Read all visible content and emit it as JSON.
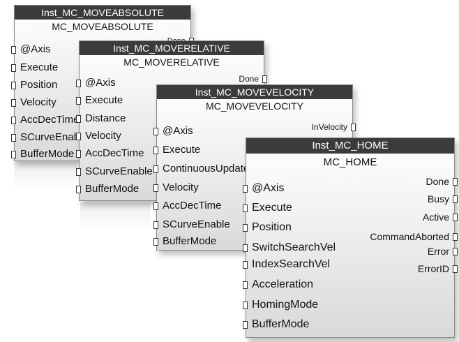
{
  "blocks": [
    {
      "instance": "Inst_MC_MOVEABSOLUTE",
      "type": "MC_MOVEABSOLUTE",
      "inputs": [
        "@Axis",
        "Execute",
        "Position",
        "Velocity",
        "AccDecTime",
        "SCurveEnable",
        "BufferMode"
      ],
      "outputs": [
        "Done"
      ]
    },
    {
      "instance": "Inst_MC_MOVERELATIVE",
      "type": "MC_MOVERELATIVE",
      "inputs": [
        "@Axis",
        "Execute",
        "Distance",
        "Velocity",
        "AccDecTime",
        "SCurveEnable",
        "BufferMode"
      ],
      "outputs": [
        "Done"
      ]
    },
    {
      "instance": "Inst_MC_MOVEVELOCITY",
      "type": "MC_MOVEVELOCITY",
      "inputs": [
        "@Axis",
        "Execute",
        "ContinuousUpdate",
        "Velocity",
        "AccDecTime",
        "SCurveEnable",
        "BufferMode"
      ],
      "outputs": [
        "InVelocity"
      ]
    },
    {
      "instance": "Inst_MC_HOME",
      "type": "MC_HOME",
      "inputs": [
        "@Axis",
        "Execute",
        "Position",
        "SwitchSearchVel",
        "IndexSearchVel",
        "Acceleration",
        "HomingMode",
        "BufferMode"
      ],
      "outputs": [
        "Done",
        "Busy",
        "Active",
        "CommandAborted",
        "Error",
        "ErrorID"
      ]
    }
  ]
}
